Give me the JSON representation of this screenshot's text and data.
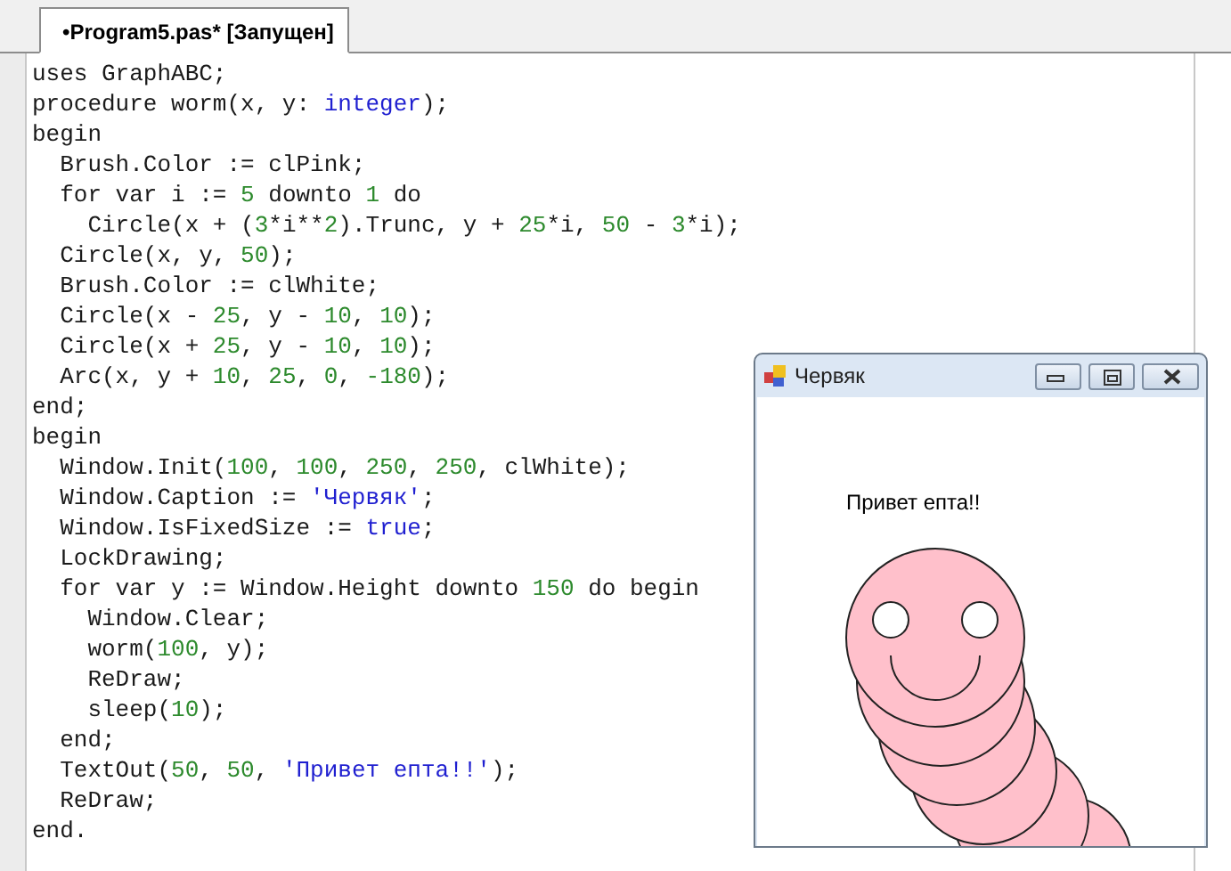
{
  "tab": {
    "label": "•Program5.pas* [Запущен]",
    "selected": true
  },
  "editor": {
    "lines": [
      [
        {
          "kind": "plain",
          "text": "uses GraphABC;"
        }
      ],
      [
        {
          "kind": "plain",
          "text": "procedure worm(x, y: "
        },
        {
          "kind": "keyword",
          "text": "integer"
        },
        {
          "kind": "plain",
          "text": ");"
        }
      ],
      [
        {
          "kind": "plain",
          "text": "begin"
        }
      ],
      [
        {
          "kind": "plain",
          "text": "  Brush.Color := clPink;"
        }
      ],
      [
        {
          "kind": "plain",
          "text": "  for var i := "
        },
        {
          "kind": "number",
          "text": "5"
        },
        {
          "kind": "plain",
          "text": " downto "
        },
        {
          "kind": "number",
          "text": "1"
        },
        {
          "kind": "plain",
          "text": " do"
        }
      ],
      [
        {
          "kind": "plain",
          "text": "    Circle(x + ("
        },
        {
          "kind": "number",
          "text": "3"
        },
        {
          "kind": "plain",
          "text": "*i**"
        },
        {
          "kind": "number",
          "text": "2"
        },
        {
          "kind": "plain",
          "text": ").Trunc, y + "
        },
        {
          "kind": "number",
          "text": "25"
        },
        {
          "kind": "plain",
          "text": "*i, "
        },
        {
          "kind": "number",
          "text": "50"
        },
        {
          "kind": "plain",
          "text": " - "
        },
        {
          "kind": "number",
          "text": "3"
        },
        {
          "kind": "plain",
          "text": "*i);"
        }
      ],
      [
        {
          "kind": "plain",
          "text": "  Circle(x, y, "
        },
        {
          "kind": "number",
          "text": "50"
        },
        {
          "kind": "plain",
          "text": ");"
        }
      ],
      [
        {
          "kind": "plain",
          "text": "  Brush.Color := clWhite;"
        }
      ],
      [
        {
          "kind": "plain",
          "text": "  Circle(x - "
        },
        {
          "kind": "number",
          "text": "25"
        },
        {
          "kind": "plain",
          "text": ", y - "
        },
        {
          "kind": "number",
          "text": "10"
        },
        {
          "kind": "plain",
          "text": ", "
        },
        {
          "kind": "number",
          "text": "10"
        },
        {
          "kind": "plain",
          "text": ");"
        }
      ],
      [
        {
          "kind": "plain",
          "text": "  Circle(x + "
        },
        {
          "kind": "number",
          "text": "25"
        },
        {
          "kind": "plain",
          "text": ", y - "
        },
        {
          "kind": "number",
          "text": "10"
        },
        {
          "kind": "plain",
          "text": ", "
        },
        {
          "kind": "number",
          "text": "10"
        },
        {
          "kind": "plain",
          "text": ");"
        }
      ],
      [
        {
          "kind": "plain",
          "text": "  Arc(x, y + "
        },
        {
          "kind": "number",
          "text": "10"
        },
        {
          "kind": "plain",
          "text": ", "
        },
        {
          "kind": "number",
          "text": "25"
        },
        {
          "kind": "plain",
          "text": ", "
        },
        {
          "kind": "number",
          "text": "0"
        },
        {
          "kind": "plain",
          "text": ", "
        },
        {
          "kind": "number",
          "text": "-180"
        },
        {
          "kind": "plain",
          "text": ");"
        }
      ],
      [
        {
          "kind": "plain",
          "text": "end;"
        }
      ],
      [
        {
          "kind": "plain",
          "text": "begin"
        }
      ],
      [
        {
          "kind": "plain",
          "text": "  Window.Init("
        },
        {
          "kind": "number",
          "text": "100"
        },
        {
          "kind": "plain",
          "text": ", "
        },
        {
          "kind": "number",
          "text": "100"
        },
        {
          "kind": "plain",
          "text": ", "
        },
        {
          "kind": "number",
          "text": "250"
        },
        {
          "kind": "plain",
          "text": ", "
        },
        {
          "kind": "number",
          "text": "250"
        },
        {
          "kind": "plain",
          "text": ", clWhite);"
        }
      ],
      [
        {
          "kind": "plain",
          "text": "  Window.Caption := "
        },
        {
          "kind": "string",
          "text": "'Червяк'"
        },
        {
          "kind": "plain",
          "text": ";"
        }
      ],
      [
        {
          "kind": "plain",
          "text": "  Window.IsFixedSize := "
        },
        {
          "kind": "keyword",
          "text": "true"
        },
        {
          "kind": "plain",
          "text": ";"
        }
      ],
      [
        {
          "kind": "plain",
          "text": "  LockDrawing;"
        }
      ],
      [
        {
          "kind": "plain",
          "text": "  for var y := Window.Height downto "
        },
        {
          "kind": "number",
          "text": "150"
        },
        {
          "kind": "plain",
          "text": " do begin"
        }
      ],
      [
        {
          "kind": "plain",
          "text": "    Window.Clear;"
        }
      ],
      [
        {
          "kind": "plain",
          "text": "    worm("
        },
        {
          "kind": "number",
          "text": "100"
        },
        {
          "kind": "plain",
          "text": ", y);"
        }
      ],
      [
        {
          "kind": "plain",
          "text": "    ReDraw;"
        }
      ],
      [
        {
          "kind": "plain",
          "text": "    sleep("
        },
        {
          "kind": "number",
          "text": "10"
        },
        {
          "kind": "plain",
          "text": ");"
        }
      ],
      [
        {
          "kind": "plain",
          "text": "  end;"
        }
      ],
      [
        {
          "kind": "plain",
          "text": "  TextOut("
        },
        {
          "kind": "number",
          "text": "50"
        },
        {
          "kind": "plain",
          "text": ", "
        },
        {
          "kind": "number",
          "text": "50"
        },
        {
          "kind": "plain",
          "text": ", "
        },
        {
          "kind": "string",
          "text": "'Привет епта!!'"
        },
        {
          "kind": "plain",
          "text": ");"
        }
      ],
      [
        {
          "kind": "plain",
          "text": "  ReDraw;"
        }
      ],
      [
        {
          "kind": "plain",
          "text": "end."
        }
      ]
    ]
  },
  "graphics_window": {
    "title": "Червяк",
    "text": "Привет епта!!"
  }
}
